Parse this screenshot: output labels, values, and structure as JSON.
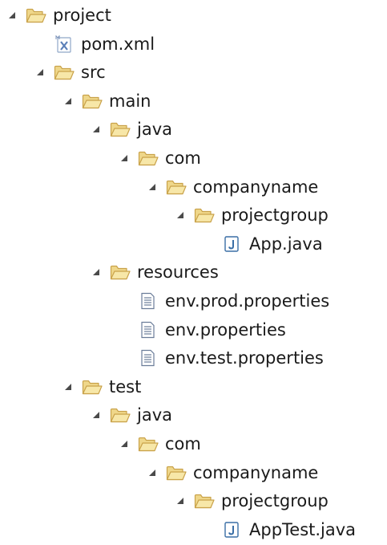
{
  "tree": {
    "items": [
      {
        "label": "project",
        "type": "folder",
        "expanded": true,
        "depth": 0
      },
      {
        "label": "pom.xml",
        "type": "xml-file",
        "depth": 1
      },
      {
        "label": "src",
        "type": "folder",
        "expanded": true,
        "depth": 1
      },
      {
        "label": "main",
        "type": "folder",
        "expanded": true,
        "depth": 2
      },
      {
        "label": "java",
        "type": "folder",
        "expanded": true,
        "depth": 3
      },
      {
        "label": "com",
        "type": "folder",
        "expanded": true,
        "depth": 4
      },
      {
        "label": "companyname",
        "type": "folder",
        "expanded": true,
        "depth": 5
      },
      {
        "label": "projectgroup",
        "type": "folder",
        "expanded": true,
        "depth": 6
      },
      {
        "label": "App.java",
        "type": "java-file",
        "depth": 7
      },
      {
        "label": "resources",
        "type": "folder",
        "expanded": true,
        "depth": 3
      },
      {
        "label": "env.prod.properties",
        "type": "properties-file",
        "depth": 4
      },
      {
        "label": "env.properties",
        "type": "properties-file",
        "depth": 4
      },
      {
        "label": "env.test.properties",
        "type": "properties-file",
        "depth": 4
      },
      {
        "label": "test",
        "type": "folder",
        "expanded": true,
        "depth": 2
      },
      {
        "label": "java",
        "type": "folder",
        "expanded": true,
        "depth": 3
      },
      {
        "label": "com",
        "type": "folder",
        "expanded": true,
        "depth": 4
      },
      {
        "label": "companyname",
        "type": "folder",
        "expanded": true,
        "depth": 5
      },
      {
        "label": "projectgroup",
        "type": "folder",
        "expanded": true,
        "depth": 6
      },
      {
        "label": "AppTest.java",
        "type": "java-file",
        "depth": 7
      }
    ]
  },
  "colors": {
    "folder_fill": "#f7e7a8",
    "folder_stroke": "#c9a24a",
    "arrow": "#4a4a4a",
    "java_icon": "#3a6ea5",
    "xml_icon": "#5a7fb8",
    "properties_icon": "#6b7d99"
  }
}
